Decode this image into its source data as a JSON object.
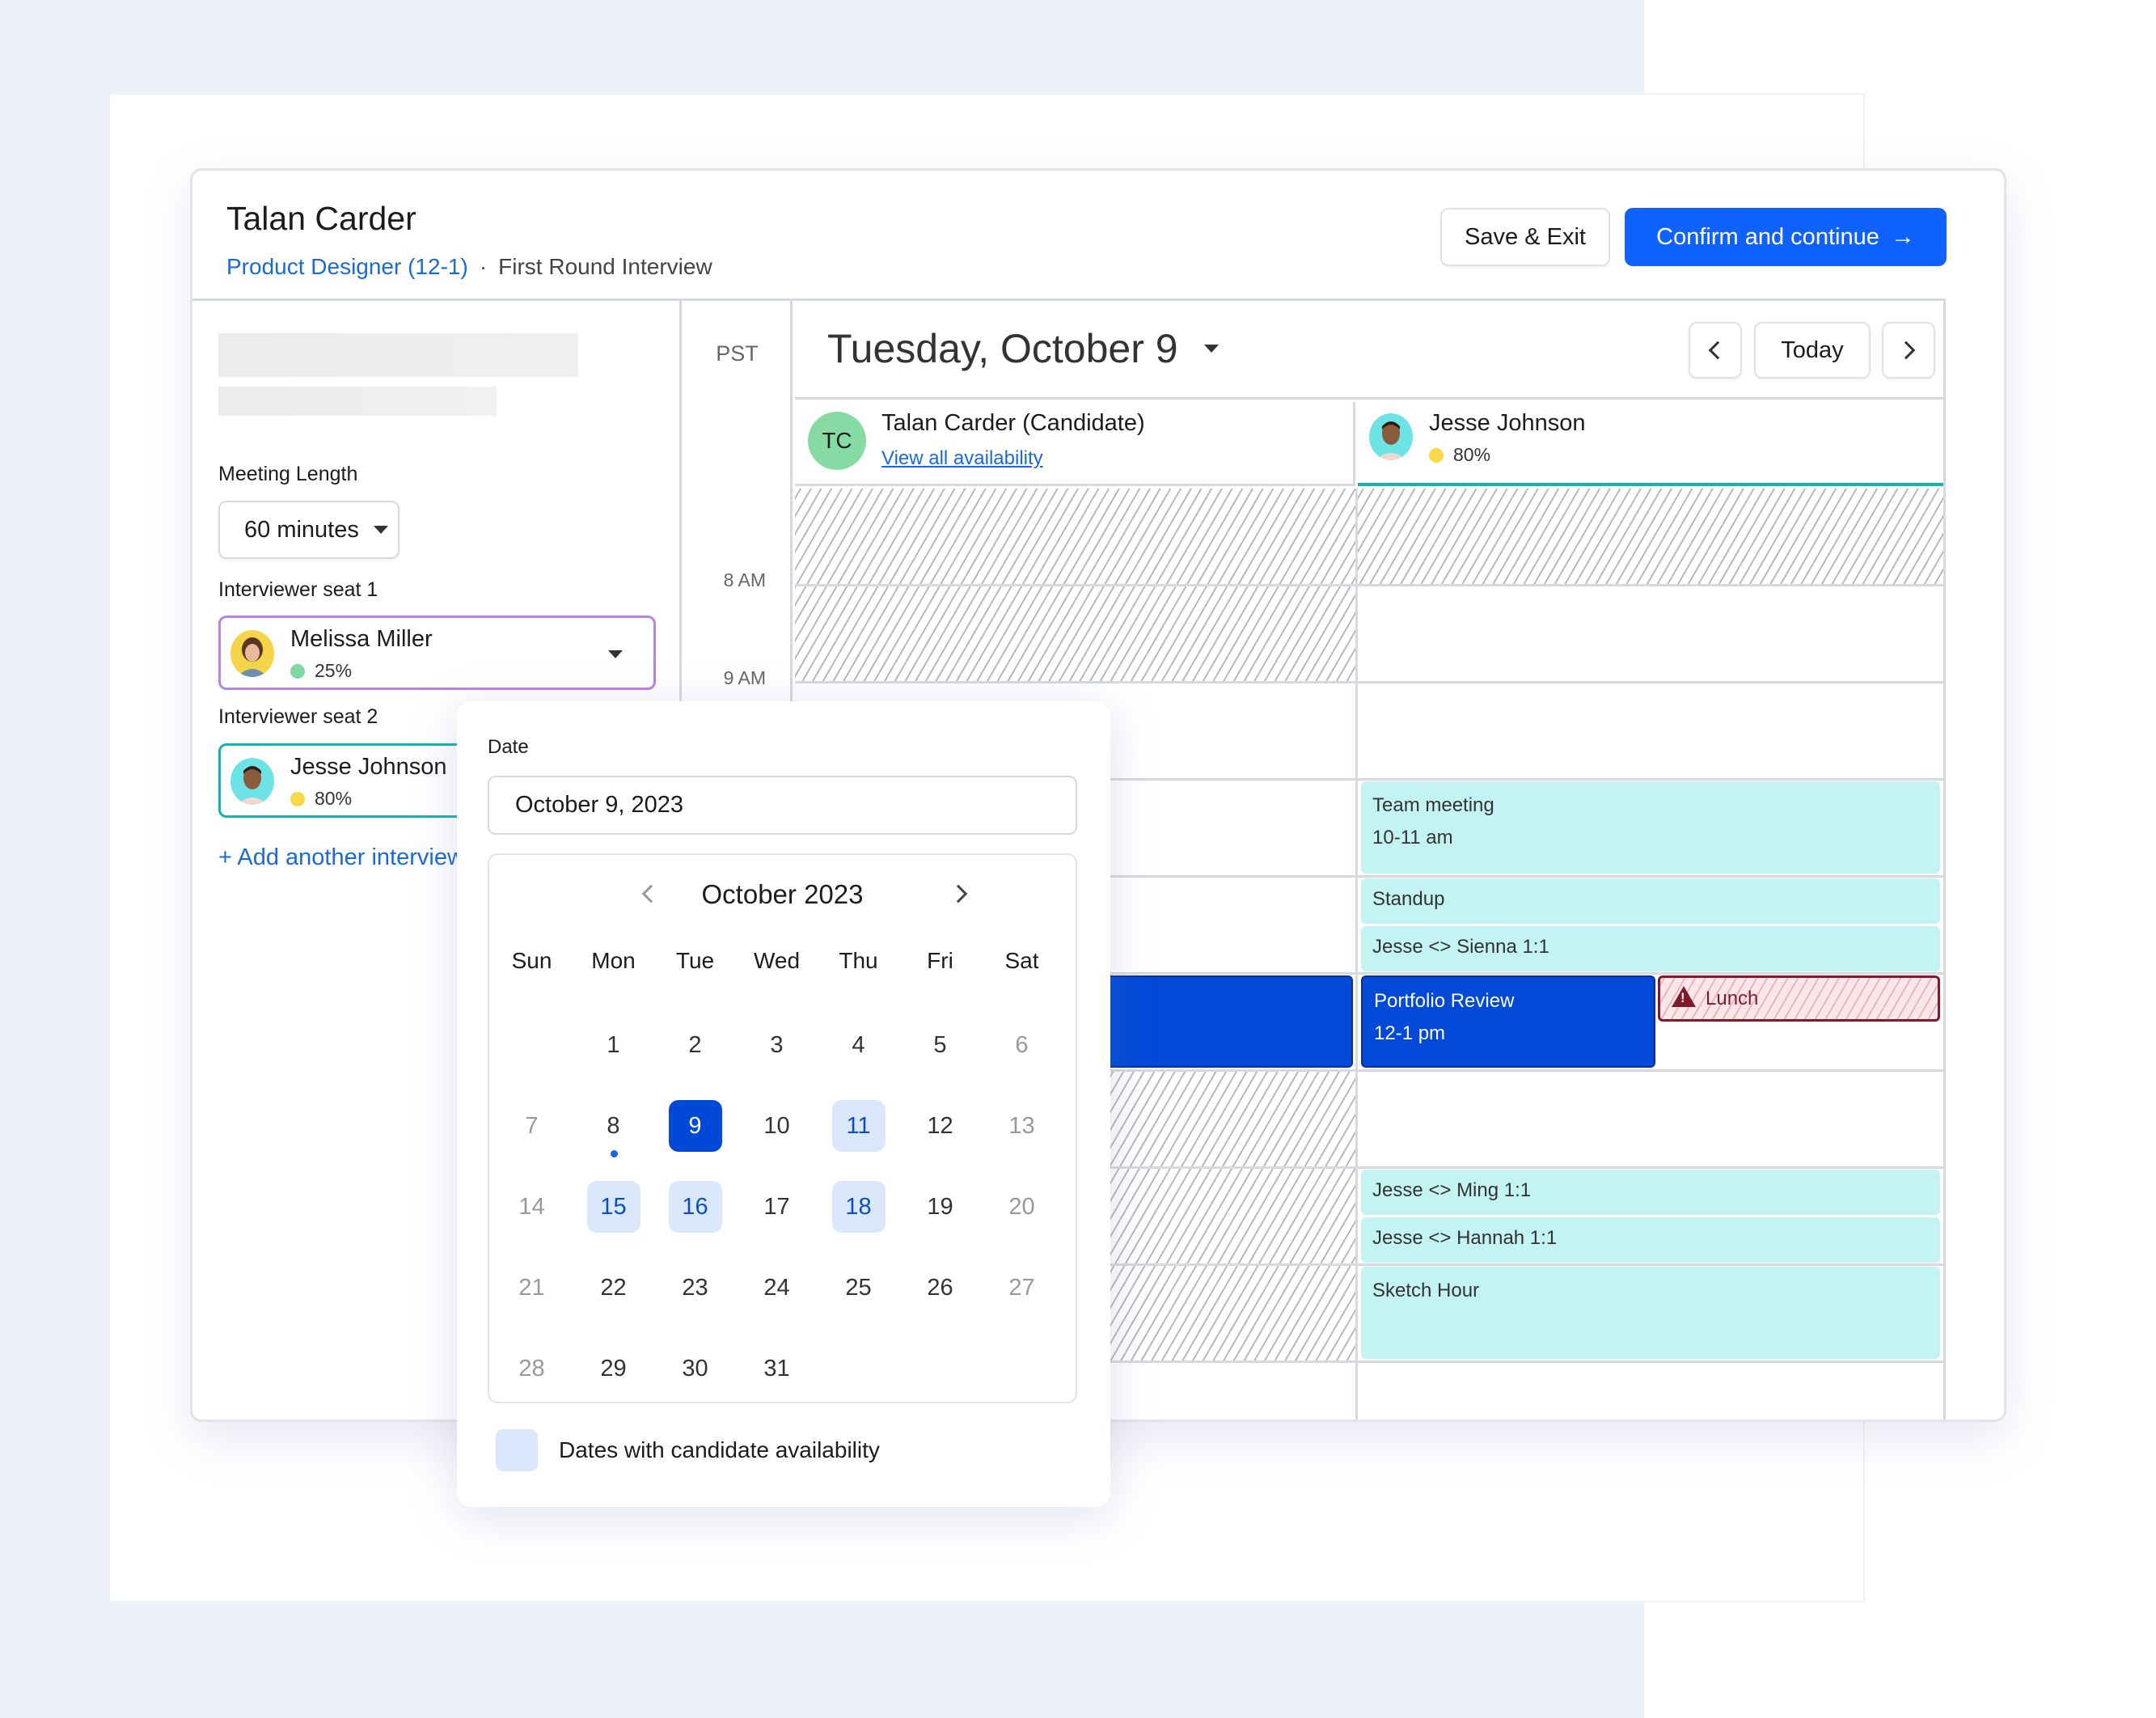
{
  "header": {
    "candidate_name": "Talan Carder",
    "job_link": "Product Designer (12-1)",
    "separator": "·",
    "stage": "First Round Interview",
    "save_label": "Save & Exit",
    "confirm_label": "Confirm and continue",
    "confirm_icon": "arrow-right-icon"
  },
  "sidebar": {
    "meeting_length_label": "Meeting Length",
    "meeting_length_value": "60 minutes",
    "seats": [
      {
        "label": "Interviewer seat 1",
        "name": "Melissa Miller",
        "load": "25%",
        "load_color": "#7fd9a3",
        "border_color": "#b785e0"
      },
      {
        "label": "Interviewer seat 2",
        "name": "Jesse Johnson",
        "load": "80%",
        "load_color": "#f9d84a",
        "border_color": "#17b1b1"
      }
    ],
    "add_interviewer": "+ Add another interviewer"
  },
  "calendar": {
    "timezone": "PST",
    "date_title": "Tuesday, October 9",
    "today_label": "Today",
    "time_labels": [
      "8 AM",
      "9 AM"
    ],
    "columns": [
      {
        "name": "Talan Carder (Candidate)",
        "initials": "TC",
        "link": "View all availability"
      },
      {
        "name": "Jesse Johnson",
        "load": "80%",
        "load_color": "#f9d84a"
      }
    ],
    "events": [
      {
        "title": "Team meeting",
        "time": "10-11 am"
      },
      {
        "title": "Standup"
      },
      {
        "title": "Jesse <> Sienna 1:1"
      },
      {
        "title": "Portfolio Review",
        "time": "12-1 pm"
      },
      {
        "title": "Lunch",
        "warning": true
      },
      {
        "title": "Jesse <> Ming 1:1"
      },
      {
        "title": "Jesse <> Hannah 1:1"
      },
      {
        "title": "Sketch Hour"
      }
    ],
    "colors": {
      "event_teal": "#c3f3f3",
      "event_blue": "#0249d8",
      "lunch_border": "#7d1b2a",
      "accent": "#0f62fe"
    }
  },
  "datepicker": {
    "label": "Date",
    "value": "October 9, 2023",
    "month_title": "October 2023",
    "weekdays": [
      "Sun",
      "Mon",
      "Tue",
      "Wed",
      "Thu",
      "Fri",
      "Sat"
    ],
    "weeks": [
      [
        "",
        "1",
        "2",
        "3",
        "4",
        "5",
        "6"
      ],
      [
        "7",
        "8",
        "9",
        "10",
        "11",
        "12",
        "13"
      ],
      [
        "14",
        "15",
        "16",
        "17",
        "18",
        "19",
        "20"
      ],
      [
        "21",
        "22",
        "23",
        "24",
        "25",
        "26",
        "27"
      ],
      [
        "28",
        "29",
        "30",
        "31",
        "",
        "",
        ""
      ]
    ],
    "selected_day": "9",
    "today_day": "8",
    "available_days": [
      "11",
      "15",
      "16",
      "18"
    ],
    "legend": "Dates with candidate availability"
  }
}
